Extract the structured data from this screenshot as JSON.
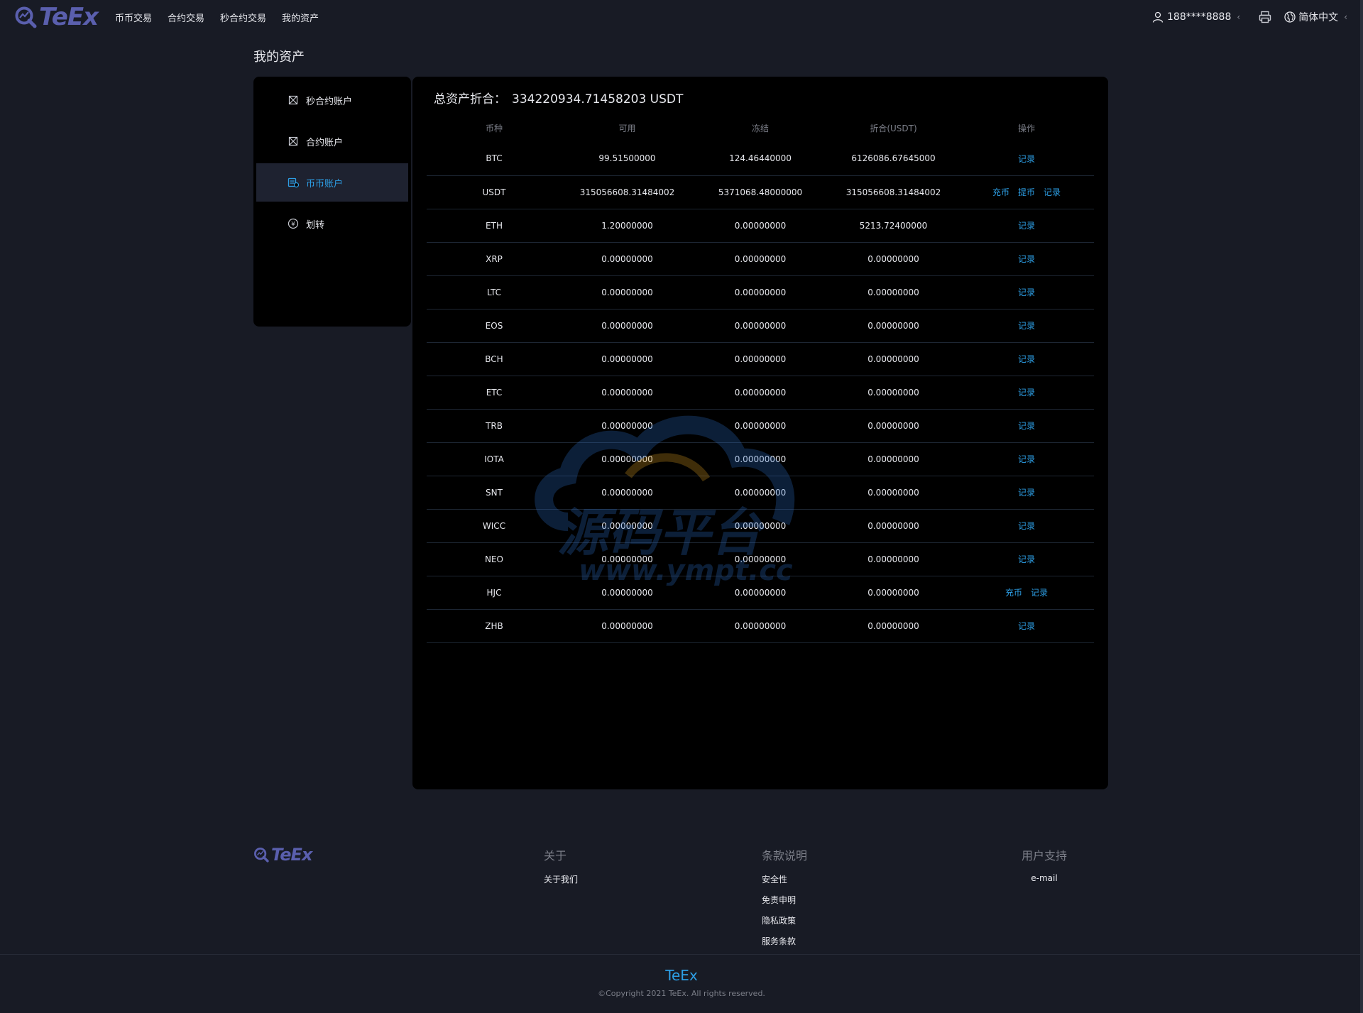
{
  "header": {
    "logo_text": "TeEx",
    "nav": [
      {
        "label": "币币交易"
      },
      {
        "label": "合约交易"
      },
      {
        "label": "秒合约交易"
      },
      {
        "label": "我的资产"
      }
    ],
    "user": "188****8888",
    "language": "简体中文"
  },
  "page_title": "我的资产",
  "sidebar": {
    "items": [
      {
        "label": "秒合约账户",
        "icon": "contract-icon",
        "active": false
      },
      {
        "label": "合约账户",
        "icon": "contract-icon",
        "active": false
      },
      {
        "label": "币币账户",
        "icon": "wallet-icon",
        "active": true
      },
      {
        "label": "划转",
        "icon": "transfer-icon",
        "active": false
      }
    ]
  },
  "summary": {
    "label": "总资产折合：",
    "value": "334220934.71458203 USDT"
  },
  "table": {
    "columns": [
      "币种",
      "可用",
      "冻结",
      "折合(USDT)",
      "操作"
    ],
    "rows": [
      {
        "coin": "BTC",
        "available": "99.51500000",
        "frozen": "124.46440000",
        "usdt": "6126086.67645000",
        "actions": [
          "记录"
        ]
      },
      {
        "coin": "USDT",
        "available": "315056608.31484002",
        "frozen": "5371068.48000000",
        "usdt": "315056608.31484002",
        "actions": [
          "充币",
          "提币",
          "记录"
        ]
      },
      {
        "coin": "ETH",
        "available": "1.20000000",
        "frozen": "0.00000000",
        "usdt": "5213.72400000",
        "actions": [
          "记录"
        ]
      },
      {
        "coin": "XRP",
        "available": "0.00000000",
        "frozen": "0.00000000",
        "usdt": "0.00000000",
        "actions": [
          "记录"
        ]
      },
      {
        "coin": "LTC",
        "available": "0.00000000",
        "frozen": "0.00000000",
        "usdt": "0.00000000",
        "actions": [
          "记录"
        ]
      },
      {
        "coin": "EOS",
        "available": "0.00000000",
        "frozen": "0.00000000",
        "usdt": "0.00000000",
        "actions": [
          "记录"
        ]
      },
      {
        "coin": "BCH",
        "available": "0.00000000",
        "frozen": "0.00000000",
        "usdt": "0.00000000",
        "actions": [
          "记录"
        ]
      },
      {
        "coin": "ETC",
        "available": "0.00000000",
        "frozen": "0.00000000",
        "usdt": "0.00000000",
        "actions": [
          "记录"
        ]
      },
      {
        "coin": "TRB",
        "available": "0.00000000",
        "frozen": "0.00000000",
        "usdt": "0.00000000",
        "actions": [
          "记录"
        ]
      },
      {
        "coin": "IOTA",
        "available": "0.00000000",
        "frozen": "0.00000000",
        "usdt": "0.00000000",
        "actions": [
          "记录"
        ]
      },
      {
        "coin": "SNT",
        "available": "0.00000000",
        "frozen": "0.00000000",
        "usdt": "0.00000000",
        "actions": [
          "记录"
        ]
      },
      {
        "coin": "WICC",
        "available": "0.00000000",
        "frozen": "0.00000000",
        "usdt": "0.00000000",
        "actions": [
          "记录"
        ]
      },
      {
        "coin": "NEO",
        "available": "0.00000000",
        "frozen": "0.00000000",
        "usdt": "0.00000000",
        "actions": [
          "记录"
        ]
      },
      {
        "coin": "HJC",
        "available": "0.00000000",
        "frozen": "0.00000000",
        "usdt": "0.00000000",
        "actions": [
          "充币",
          "记录"
        ]
      },
      {
        "coin": "ZHB",
        "available": "0.00000000",
        "frozen": "0.00000000",
        "usdt": "0.00000000",
        "actions": [
          "记录"
        ]
      }
    ]
  },
  "footer": {
    "logo_text": "TeEx",
    "about": {
      "title": "关于",
      "links": [
        "关于我们"
      ]
    },
    "terms": {
      "title": "条款说明",
      "links": [
        "安全性",
        "免责申明",
        "隐私政策",
        "服务条款"
      ]
    },
    "support": {
      "title": "用户支持",
      "links": [
        "e-mail"
      ]
    },
    "brand": "TeEx",
    "copyright": "©Copyright 2021 TeEx. All rights reserved."
  },
  "watermark": {
    "title": "源码平台",
    "url": "www.ympt.cc"
  },
  "colors": {
    "accent": "#2d9fe6",
    "logo": "#5a5fae",
    "background": "#181b25",
    "panel": "#000000"
  }
}
